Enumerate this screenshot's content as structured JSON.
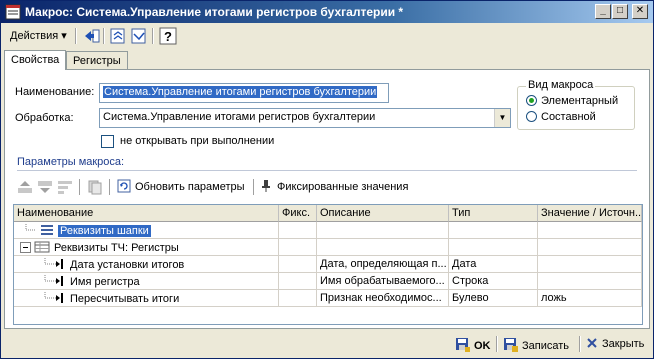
{
  "window": {
    "title": "Макрос: Система.Управление итогами регистров бухгалтерии *",
    "min_label": "_",
    "max_label": "□",
    "close_label": "✕"
  },
  "toolbar": {
    "actions_label": "Действия",
    "actions_arrow": "▾"
  },
  "tabs": [
    {
      "label": "Свойства",
      "active": true
    },
    {
      "label": "Регистры",
      "active": false
    }
  ],
  "form": {
    "name_label": "Наименование:",
    "name_value": "Система.Управление итогами регистров бухгалтерии",
    "processing_label": "Обработка:",
    "processing_value": "Система.Управление итогами регистров бухгалтерии",
    "dont_open_label": "не открывать при выполнении",
    "dont_open_checked": false
  },
  "macro_type": {
    "title": "Вид макроса",
    "options": [
      {
        "label": "Элементарный",
        "selected": true
      },
      {
        "label": "Составной",
        "selected": false
      }
    ]
  },
  "params": {
    "title": "Параметры макроса:",
    "refresh_label": "Обновить параметры",
    "fixed_label": "Фиксированные значения",
    "columns": [
      "Наименование",
      "Фикс.",
      "Описание",
      "Тип",
      "Значение / Источн..."
    ],
    "rows": [
      {
        "name": "Реквизиты шапки",
        "fixed": "",
        "desc": "",
        "type": "",
        "value": "",
        "selected": true
      },
      {
        "name": "Реквизиты ТЧ: Регистры",
        "fixed": "",
        "desc": "",
        "type": "",
        "value": "",
        "selected": false
      },
      {
        "name": "Дата установки итогов",
        "fixed": "",
        "desc": "Дата, определяющая п...",
        "type": "Дата",
        "value": "",
        "selected": false
      },
      {
        "name": "Имя регистра",
        "fixed": "",
        "desc": "Имя обрабатываемого...",
        "type": "Строка",
        "value": "",
        "selected": false
      },
      {
        "name": "Пересчитывать итоги",
        "fixed": "",
        "desc": "Признак необходимос...",
        "type": "Булево",
        "value": "ложь",
        "selected": false
      }
    ]
  },
  "bottom": {
    "ok_label": "OK",
    "save_label": "Записать",
    "close_label": "Закрыть"
  }
}
